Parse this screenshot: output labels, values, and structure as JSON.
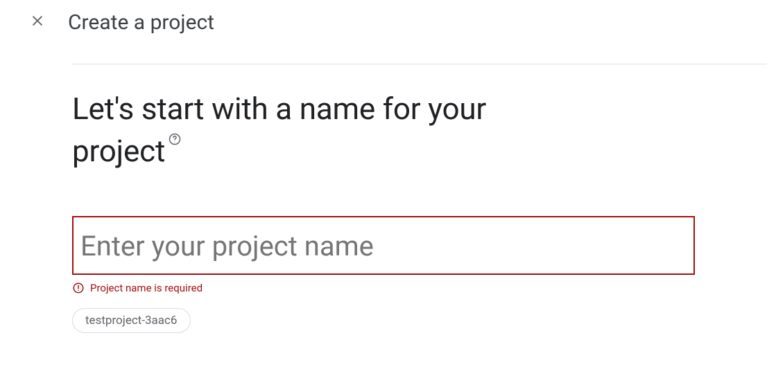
{
  "header": {
    "title": "Create a project"
  },
  "main": {
    "heading": "Let's start with a name for your project",
    "input": {
      "placeholder": "Enter your project name",
      "value": "",
      "error": "Project name is required"
    },
    "suggested_id": "testproject-3aac6"
  }
}
